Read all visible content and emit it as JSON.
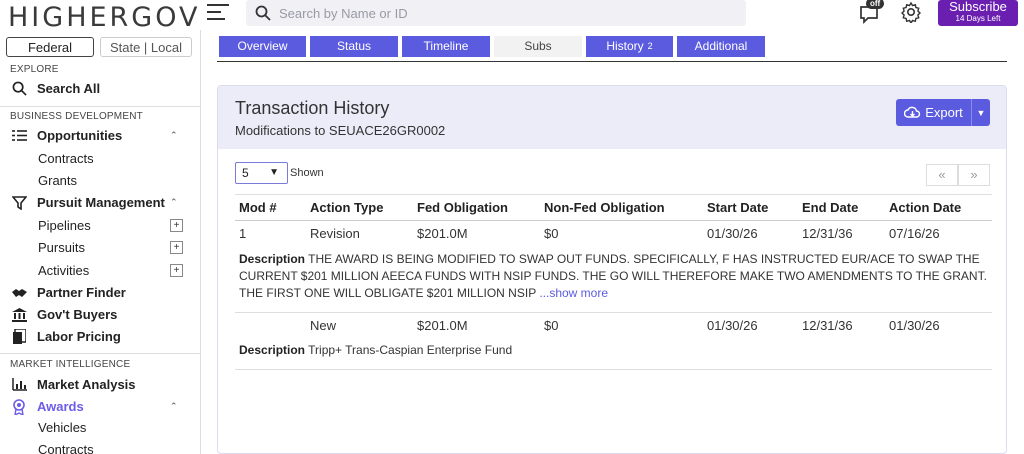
{
  "brand": {
    "logo": "HIGHERGOV"
  },
  "search": {
    "placeholder": "Search by Name or ID"
  },
  "header": {
    "notif_badge": "off",
    "subscribe": "Subscribe",
    "trial": "14 Days Left"
  },
  "sidebar": {
    "toggle": {
      "federal": "Federal",
      "state_local": "State | Local"
    },
    "explore_label": "EXPLORE",
    "search_all": "Search All",
    "bizdev_label": "BUSINESS DEVELOPMENT",
    "opportunities": "Opportunities",
    "contracts": "Contracts",
    "grants": "Grants",
    "pursuit_mgmt": "Pursuit Management",
    "pipelines": "Pipelines",
    "pursuits": "Pursuits",
    "activities": "Activities",
    "partner_finder": "Partner Finder",
    "govt_buyers": "Gov't Buyers",
    "labor_pricing": "Labor Pricing",
    "mi_label": "MARKET INTELLIGENCE",
    "market_analysis": "Market Analysis",
    "awards": "Awards",
    "vehicles": "Vehicles",
    "contracts2": "Contracts"
  },
  "tabs": [
    {
      "label": "Overview"
    },
    {
      "label": "Status"
    },
    {
      "label": "Timeline"
    },
    {
      "label": "Subs"
    },
    {
      "label": "History",
      "count": "2"
    },
    {
      "label": "Additional"
    }
  ],
  "card": {
    "title": "Transaction History",
    "subtitle": "Modifications to SEUACE26GR0002",
    "export": "Export",
    "page_size": "5",
    "shown": "Shown",
    "prev": "«",
    "next": "»",
    "columns": [
      "Mod #",
      "Action Type",
      "Fed Obligation",
      "Non-Fed Obligation",
      "Start Date",
      "End Date",
      "Action Date"
    ],
    "desc_label": "Description",
    "rows": [
      {
        "mod": "1",
        "action": "Revision",
        "fed": "$201.0M",
        "nonfed": "$0",
        "start": "01/30/26",
        "end": "12/31/36",
        "action_date": "07/16/26",
        "description": "THE AWARD IS BEING MODIFIED TO SWAP OUT FUNDS. SPECIFICALLY, F HAS INSTRUCTED EUR/ACE TO SWAP THE CURRENT $201 MILLION AEECA FUNDS WITH NSIP FUNDS. THE GO WILL THEREFORE MAKE TWO AMENDMENTS TO THE GRANT. THE FIRST ONE WILL OBLIGATE $201 MILLION NSIP",
        "more": "...show more"
      },
      {
        "mod": "",
        "action": "New",
        "fed": "$201.0M",
        "nonfed": "$0",
        "start": "01/30/26",
        "end": "12/31/36",
        "action_date": "01/30/26",
        "description": "Tripp+ Trans-Caspian Enterprise Fund",
        "more": ""
      }
    ]
  }
}
